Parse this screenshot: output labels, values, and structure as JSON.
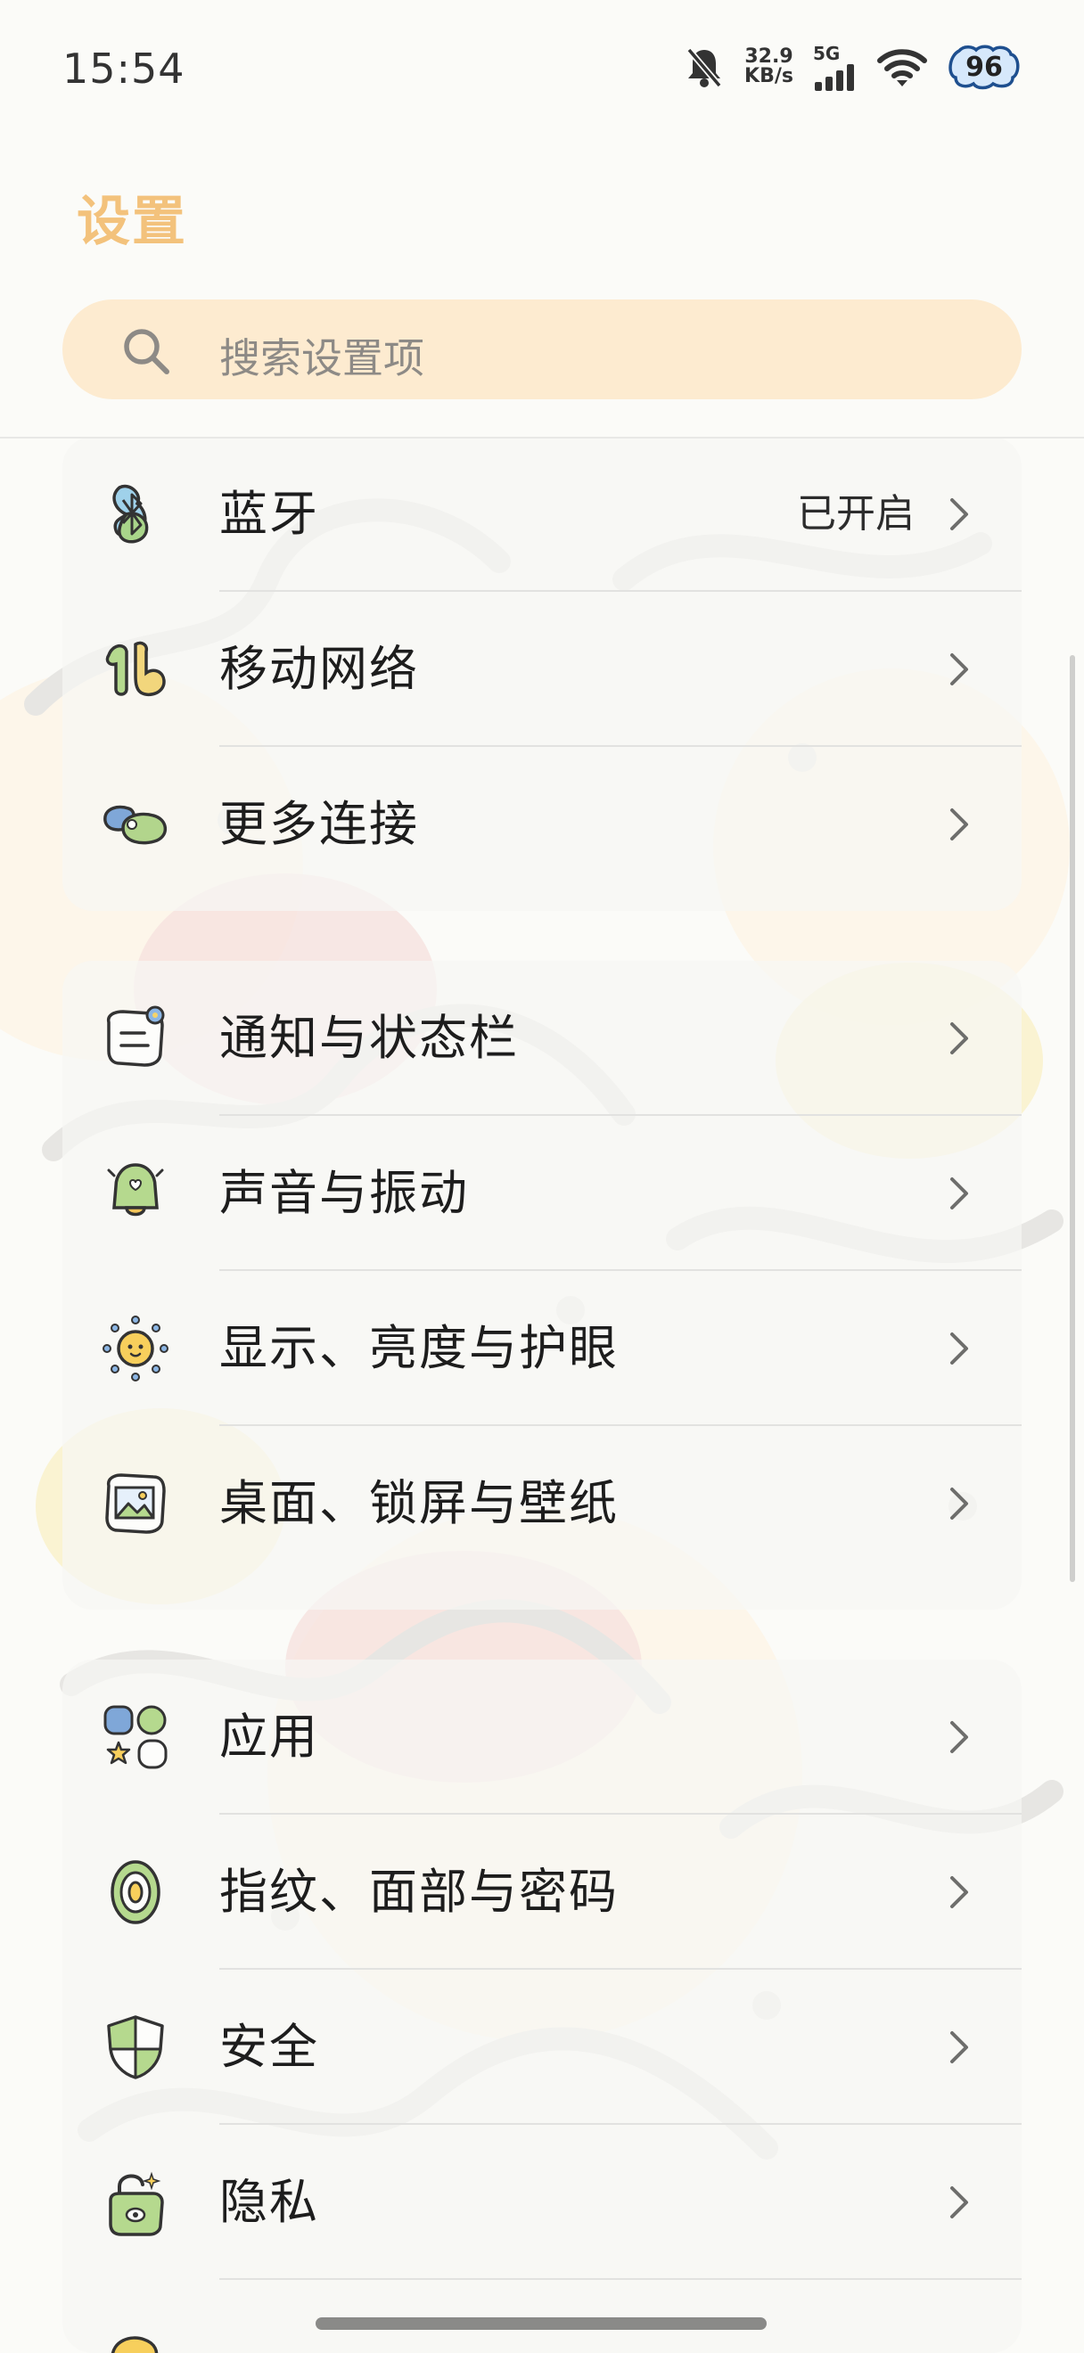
{
  "status_bar": {
    "time": "15:54",
    "net_speed_value": "32.9",
    "net_speed_unit": "KB/s",
    "network_type": "5G",
    "battery_level": "96",
    "icons": [
      "mute-bell-icon",
      "signal-icon",
      "wifi-icon",
      "battery-icon"
    ]
  },
  "header": {
    "title": "设置",
    "search_placeholder": "搜索设置项"
  },
  "accent_colors": {
    "title": "#f3c27c",
    "search_background": "#fdebd0",
    "battery_outline": "#1e4f8f",
    "battery_fill": "#d6e8fb"
  },
  "sections": [
    {
      "items": [
        {
          "label": "蓝牙",
          "value": "已开启",
          "icon": "bluetooth-icon"
        },
        {
          "label": "移动网络",
          "value": "",
          "icon": "mobile-network-icon"
        },
        {
          "label": "更多连接",
          "value": "",
          "icon": "more-connections-icon"
        }
      ]
    },
    {
      "items": [
        {
          "label": "通知与状态栏",
          "value": "",
          "icon": "notification-icon"
        },
        {
          "label": "声音与振动",
          "value": "",
          "icon": "sound-bell-icon"
        },
        {
          "label": "显示、亮度与护眼",
          "value": "",
          "icon": "sun-display-icon"
        },
        {
          "label": "桌面、锁屏与壁纸",
          "value": "",
          "icon": "wallpaper-icon"
        }
      ]
    },
    {
      "items": [
        {
          "label": "应用",
          "value": "",
          "icon": "apps-icon"
        },
        {
          "label": "指纹、面部与密码",
          "value": "",
          "icon": "fingerprint-icon"
        },
        {
          "label": "安全",
          "value": "",
          "icon": "shield-icon"
        },
        {
          "label": "隐私",
          "value": "",
          "icon": "privacy-lock-icon"
        }
      ]
    }
  ]
}
